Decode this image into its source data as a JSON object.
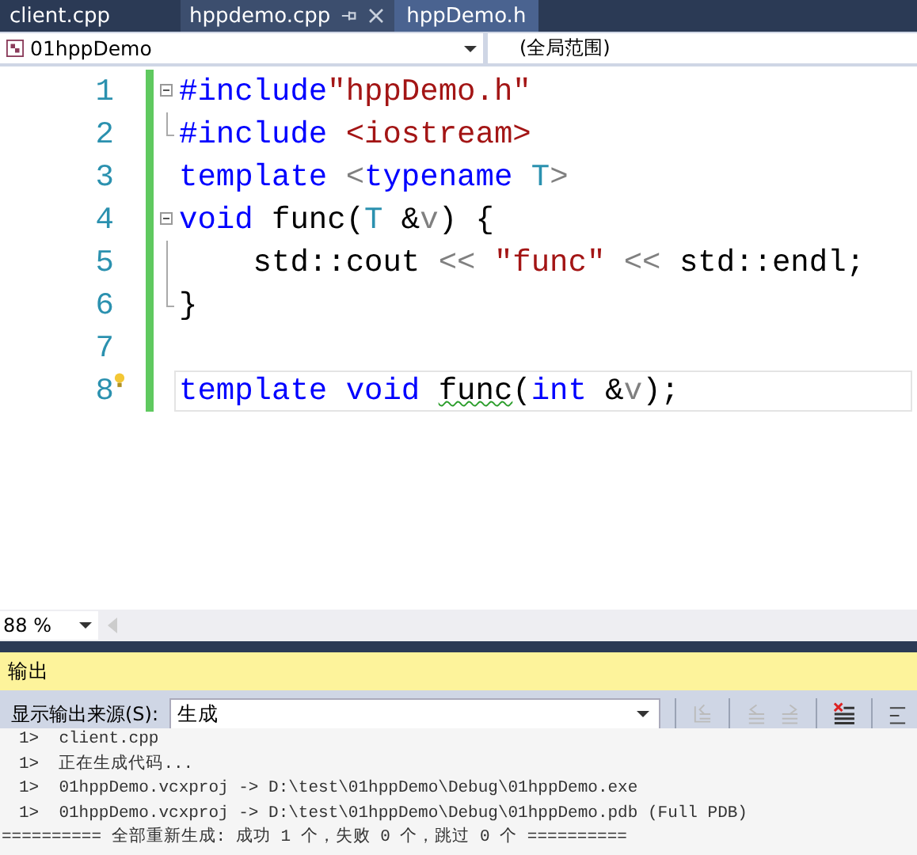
{
  "tabs": [
    {
      "label": "client.cpp",
      "selected": false
    },
    {
      "label": "hppdemo.cpp",
      "selected": true
    },
    {
      "label": "hppDemo.h",
      "selected": false
    }
  ],
  "nav": {
    "project": "01hppDemo",
    "scope": "(全局范围)"
  },
  "editor": {
    "lines": [
      {
        "number": "1",
        "kind": "foldstart",
        "current": false,
        "tokens": [
          {
            "kind": "keyword",
            "text": "#include"
          },
          {
            "kind": "string",
            "text": "\"hppDemo.h\""
          }
        ]
      },
      {
        "number": "2",
        "kind": "foldend",
        "current": false,
        "tokens": [
          {
            "kind": "keyword",
            "text": "#include "
          },
          {
            "kind": "string",
            "text": "<iostream>"
          }
        ]
      },
      {
        "number": "3",
        "kind": "plain",
        "current": false,
        "tokens": [
          {
            "kind": "keyword",
            "text": "template "
          },
          {
            "kind": "op",
            "text": "<"
          },
          {
            "kind": "keyword",
            "text": "typename "
          },
          {
            "kind": "type",
            "text": "T"
          },
          {
            "kind": "op",
            "text": ">"
          }
        ]
      },
      {
        "number": "4",
        "kind": "foldstart",
        "current": false,
        "tokens": [
          {
            "kind": "keyword",
            "text": "void"
          },
          {
            "kind": "text",
            "text": " func("
          },
          {
            "kind": "type",
            "text": "T"
          },
          {
            "kind": "text",
            "text": " &"
          },
          {
            "kind": "param",
            "text": "v"
          },
          {
            "kind": "text",
            "text": ") {"
          }
        ]
      },
      {
        "number": "5",
        "kind": "foldbody",
        "current": false,
        "tokens": [
          {
            "kind": "text",
            "text": "    std::cout "
          },
          {
            "kind": "op",
            "text": "<< "
          },
          {
            "kind": "string",
            "text": "\"func\" "
          },
          {
            "kind": "op",
            "text": "<< "
          },
          {
            "kind": "text",
            "text": "std::endl;"
          }
        ]
      },
      {
        "number": "6",
        "kind": "foldend",
        "current": false,
        "tokens": [
          {
            "kind": "text",
            "text": "}"
          }
        ]
      },
      {
        "number": "7",
        "kind": "plain",
        "current": false
      },
      {
        "number": "8",
        "kind": "plain",
        "current": true,
        "lightbulb": true,
        "tokens": [
          {
            "kind": "keyword",
            "text": "template "
          },
          {
            "kind": "keyword",
            "text": "void "
          },
          {
            "kind": "squiggle",
            "text": "func"
          },
          {
            "kind": "text",
            "text": "("
          },
          {
            "kind": "keyword",
            "text": "int "
          },
          {
            "kind": "text",
            "text": "&"
          },
          {
            "kind": "param",
            "text": "v"
          },
          {
            "kind": "text",
            "text": ");"
          }
        ]
      }
    ]
  },
  "zoom": "88 %",
  "output": {
    "title": "输出",
    "source_label": "显示输出来源(S):",
    "source": "生成",
    "lines": [
      "1>  client.cpp",
      "1>  正在生成代码...",
      "1>  01hppDemo.vcxproj -> D:\\test\\01hppDemo\\Debug\\01hppDemo.exe",
      "1>  01hppDemo.vcxproj -> D:\\test\\01hppDemo\\Debug\\01hppDemo.pdb (Full PDB)",
      "========== 全部重新生成: 成功 1 个，失败 0 个，跳过 0 个 =========="
    ]
  }
}
